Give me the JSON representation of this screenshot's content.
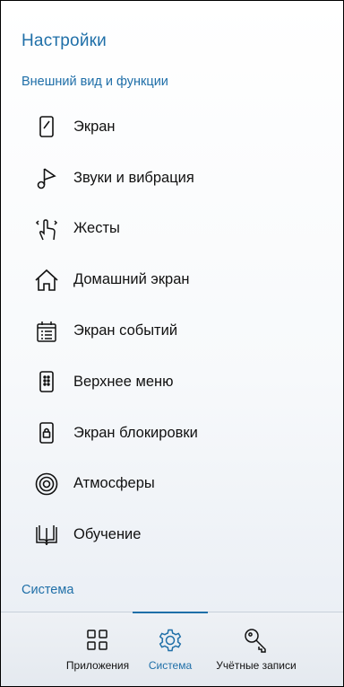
{
  "header": {
    "title": "Настройки"
  },
  "sections": {
    "appearance": "Внешний вид и функции",
    "system": "Система"
  },
  "items": [
    {
      "label": "Экран",
      "icon": "screen-icon"
    },
    {
      "label": "Звуки и вибрация",
      "icon": "music-note-icon"
    },
    {
      "label": "Жесты",
      "icon": "gesture-hand-icon"
    },
    {
      "label": "Домашний экран",
      "icon": "home-icon"
    },
    {
      "label": "Экран событий",
      "icon": "calendar-list-icon"
    },
    {
      "label": "Верхнее меню",
      "icon": "top-menu-icon"
    },
    {
      "label": "Экран блокировки",
      "icon": "lock-screen-icon"
    },
    {
      "label": "Атмосферы",
      "icon": "atmosphere-icon"
    },
    {
      "label": "Обучение",
      "icon": "book-icon"
    }
  ],
  "bottom_nav": {
    "apps": "Приложения",
    "system": "Система",
    "accounts": "Учётные записи",
    "active": "system"
  },
  "colors": {
    "accent": "#1f6fa8",
    "text": "#111111"
  }
}
